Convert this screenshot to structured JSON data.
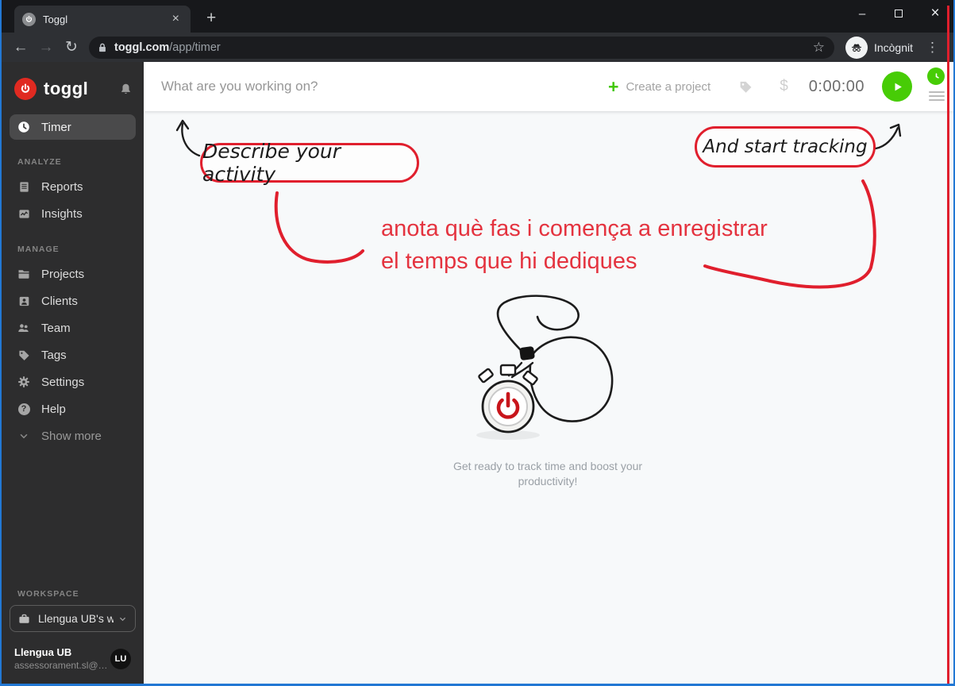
{
  "browser": {
    "tab_title": "Toggl",
    "url_host": "toggl.com",
    "url_path": "/app/timer",
    "incognito_label": "Incògnit"
  },
  "icons": {
    "close": "×",
    "new_tab": "+",
    "minimize": "–",
    "back": "←",
    "forward": "→",
    "reload": "↻",
    "star": "☆",
    "kebab": "⋮",
    "plus": "+",
    "dollar": "$",
    "question": "?"
  },
  "sidebar": {
    "brand": "toggl",
    "timer_label": "Timer",
    "sections": {
      "analyze": {
        "header": "ANALYZE",
        "items": {
          "reports": "Reports",
          "insights": "Insights"
        }
      },
      "manage": {
        "header": "MANAGE",
        "items": {
          "projects": "Projects",
          "clients": "Clients",
          "team": "Team",
          "tags": "Tags",
          "settings": "Settings",
          "help": "Help"
        }
      }
    },
    "show_more": "Show more",
    "workspace": {
      "header": "WORKSPACE",
      "name": "Llengua UB's w…"
    },
    "user": {
      "name": "Llengua UB",
      "email": "assessorament.sl@…",
      "initials": "LU"
    }
  },
  "topbar": {
    "placeholder": "What are you working on?",
    "create_project": "Create a project",
    "time": "0:00:00"
  },
  "annotations": {
    "describe": "Describe your activity",
    "start": "And start tracking",
    "catalan_line1": "anota què fas i comença a enregistrar",
    "catalan_line2": "el temps que hi dediques"
  },
  "empty_state": {
    "caption_line1": "Get ready to track time and boost your",
    "caption_line2": "productivity!"
  },
  "colors": {
    "toggl_red": "#e02a21",
    "annotation_red": "#e01f2d",
    "note_text_red": "#e4333f",
    "green": "#47cc06",
    "window_border_blue": "#2278d4"
  }
}
